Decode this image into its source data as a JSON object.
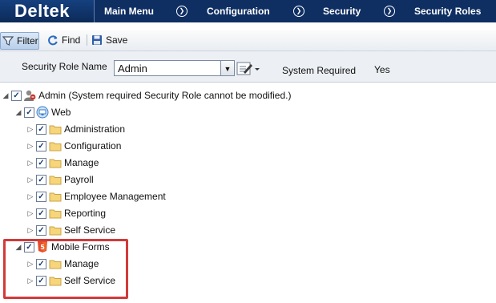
{
  "header": {
    "logo": "Deltek",
    "nav": [
      "Main Menu",
      "Configuration",
      "Security",
      "Security Roles"
    ],
    "separator_icon": "chevron-right-circle-icon",
    "bar_color": "#0f2f63"
  },
  "toolbar": {
    "filter_label": "Filter",
    "find_label": "Find",
    "save_label": "Save"
  },
  "filter": {
    "role_name_label": "Security Role Name",
    "role_name_value": "Admin",
    "system_required_label": "System Required",
    "system_required_value": "Yes"
  },
  "tree": {
    "root_label": "Admin (System required Security Role cannot be modified.)",
    "web": {
      "label": "Web",
      "children": [
        "Administration",
        "Configuration",
        "Manage",
        "Payroll",
        "Employee Management",
        "Reporting",
        "Self Service"
      ]
    },
    "mobile": {
      "label": "Mobile Forms",
      "children": [
        "Manage",
        "Self Service"
      ]
    }
  },
  "annotation_color": "#d23a3a"
}
